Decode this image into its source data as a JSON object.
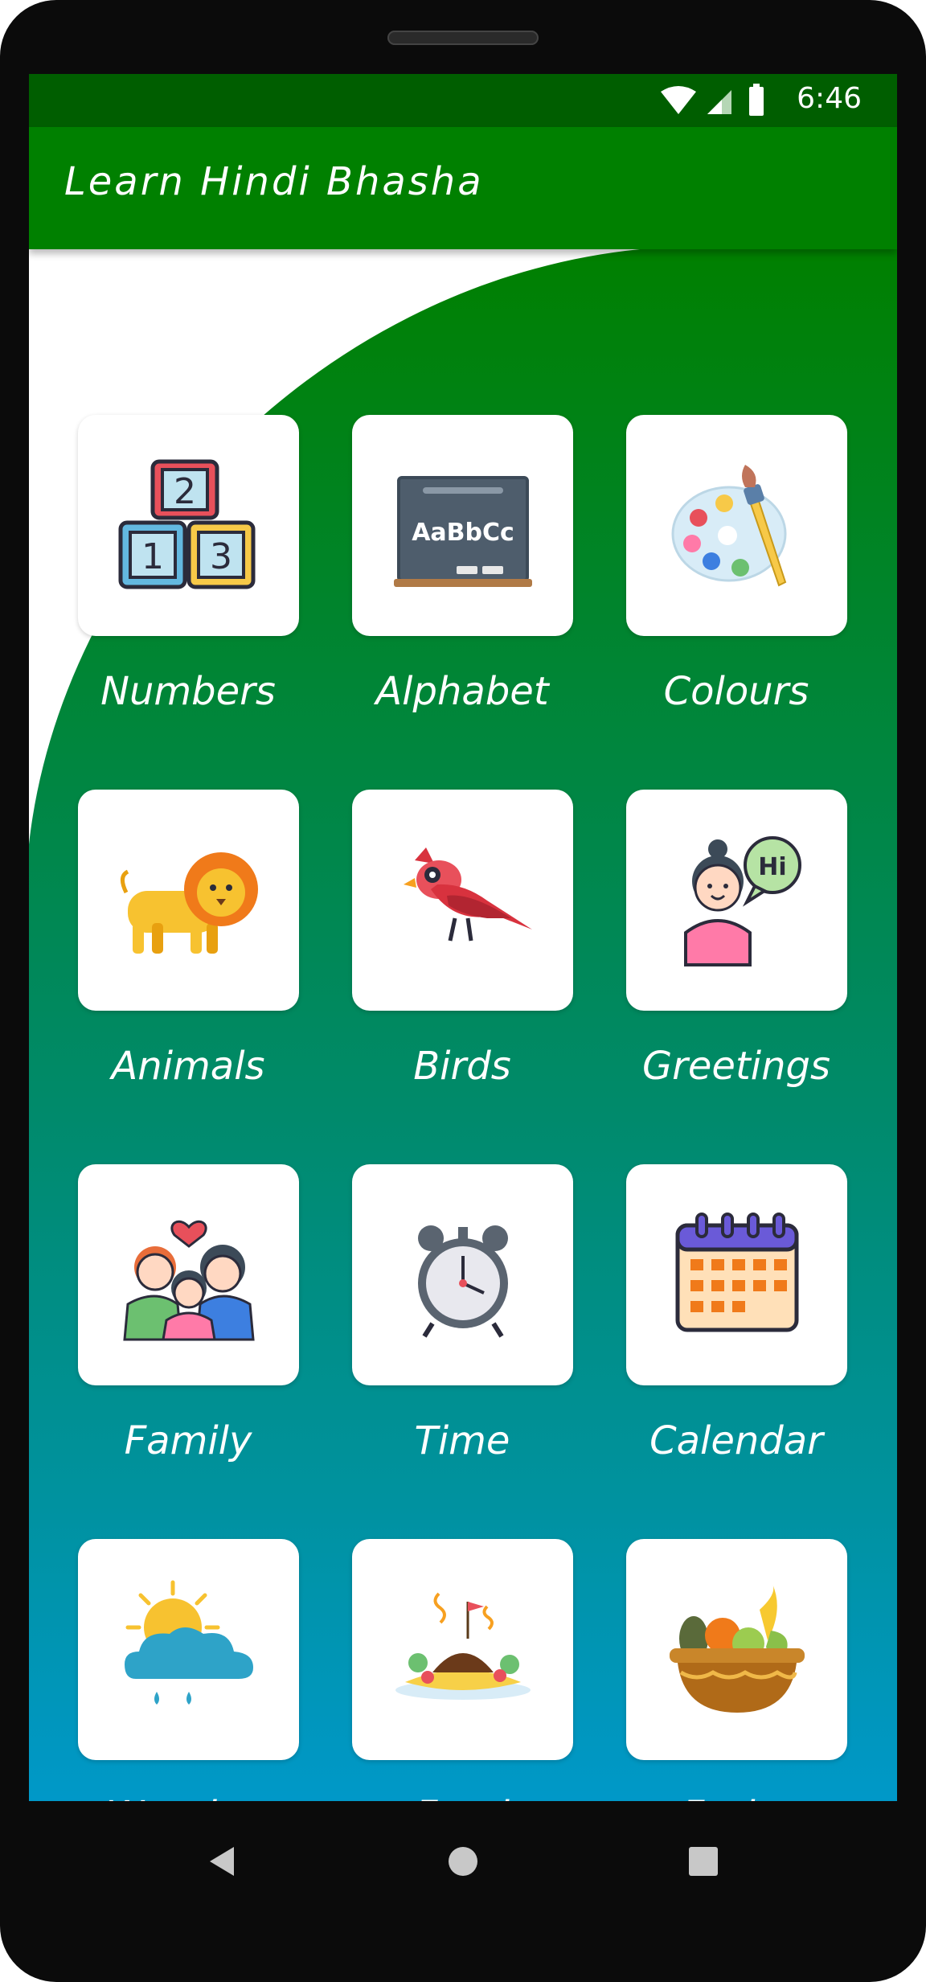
{
  "status_bar": {
    "time": "6:46",
    "icons": [
      "wifi-icon",
      "cell-signal-icon",
      "battery-icon"
    ]
  },
  "toolbar": {
    "title": "Learn Hindi Bhasha"
  },
  "colors": {
    "toolbar": "#008000",
    "status_bar": "#005e00",
    "gradient_top": "#008000",
    "gradient_bottom": "#0098c8"
  },
  "categories": [
    {
      "label": "Numbers",
      "icon": "number-blocks-icon"
    },
    {
      "label": "Alphabet",
      "icon": "chalkboard-icon"
    },
    {
      "label": "Colours",
      "icon": "paint-palette-icon"
    },
    {
      "label": "Animals",
      "icon": "lion-icon"
    },
    {
      "label": "Birds",
      "icon": "cardinal-bird-icon"
    },
    {
      "label": "Greetings",
      "icon": "greeting-girl-icon"
    },
    {
      "label": "Family",
      "icon": "family-icon"
    },
    {
      "label": "Time",
      "icon": "alarm-clock-icon"
    },
    {
      "label": "Calendar",
      "icon": "calendar-icon"
    },
    {
      "label": "Weather",
      "icon": "sun-cloud-rain-icon"
    },
    {
      "label": "Food",
      "icon": "food-plate-icon"
    },
    {
      "label": "Fruits",
      "icon": "fruit-basket-icon"
    }
  ],
  "nav_bar": {
    "buttons": [
      "back-icon",
      "home-icon",
      "recents-icon"
    ]
  }
}
